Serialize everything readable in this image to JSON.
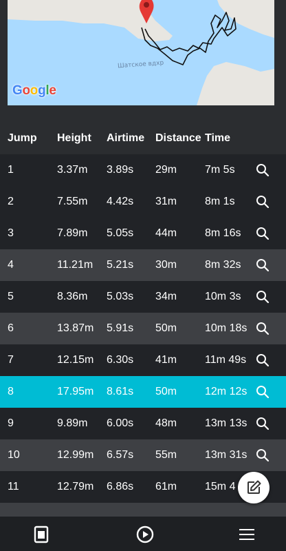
{
  "map": {
    "water_label": "Шатское вдхр",
    "attribution": "Google",
    "marker_icon": "map-pin-icon",
    "track_color": "#111111",
    "water_color": "#aadaff",
    "land_color": "#e8e6e1"
  },
  "table": {
    "headers": {
      "jump": "Jump",
      "height": "Height",
      "airtime": "Airtime",
      "distance": "Distance",
      "time": "Time"
    },
    "rows": [
      {
        "jump": "1",
        "height": "3.37m",
        "airtime": "3.89s",
        "distance": "29m",
        "time": "7m 5s"
      },
      {
        "jump": "2",
        "height": "7.55m",
        "airtime": "4.42s",
        "distance": "31m",
        "time": "8m 1s"
      },
      {
        "jump": "3",
        "height": "7.89m",
        "airtime": "5.05s",
        "distance": "44m",
        "time": "8m 16s"
      },
      {
        "jump": "4",
        "height": "11.21m",
        "airtime": "5.21s",
        "distance": "30m",
        "time": "8m 32s"
      },
      {
        "jump": "5",
        "height": "8.36m",
        "airtime": "5.03s",
        "distance": "34m",
        "time": "10m 3s"
      },
      {
        "jump": "6",
        "height": "13.87m",
        "airtime": "5.91s",
        "distance": "50m",
        "time": "10m 18s"
      },
      {
        "jump": "7",
        "height": "12.15m",
        "airtime": "6.30s",
        "distance": "41m",
        "time": "11m 49s"
      },
      {
        "jump": "8",
        "height": "17.95m",
        "airtime": "8.61s",
        "distance": "50m",
        "time": "12m 12s"
      },
      {
        "jump": "9",
        "height": "9.89m",
        "airtime": "6.00s",
        "distance": "48m",
        "time": "13m 13s"
      },
      {
        "jump": "10",
        "height": "12.99m",
        "airtime": "6.57s",
        "distance": "55m",
        "time": "13m 31s"
      },
      {
        "jump": "11",
        "height": "12.79m",
        "airtime": "6.86s",
        "distance": "61m",
        "time": "15m 4"
      }
    ],
    "selected_jump": "8",
    "row_action_icon": "search-icon",
    "selected_color": "#00bcd4"
  },
  "fab": {
    "icon": "edit-icon"
  },
  "bottom_nav": {
    "items": [
      "document-icon",
      "play-icon",
      "menu-icon"
    ]
  }
}
